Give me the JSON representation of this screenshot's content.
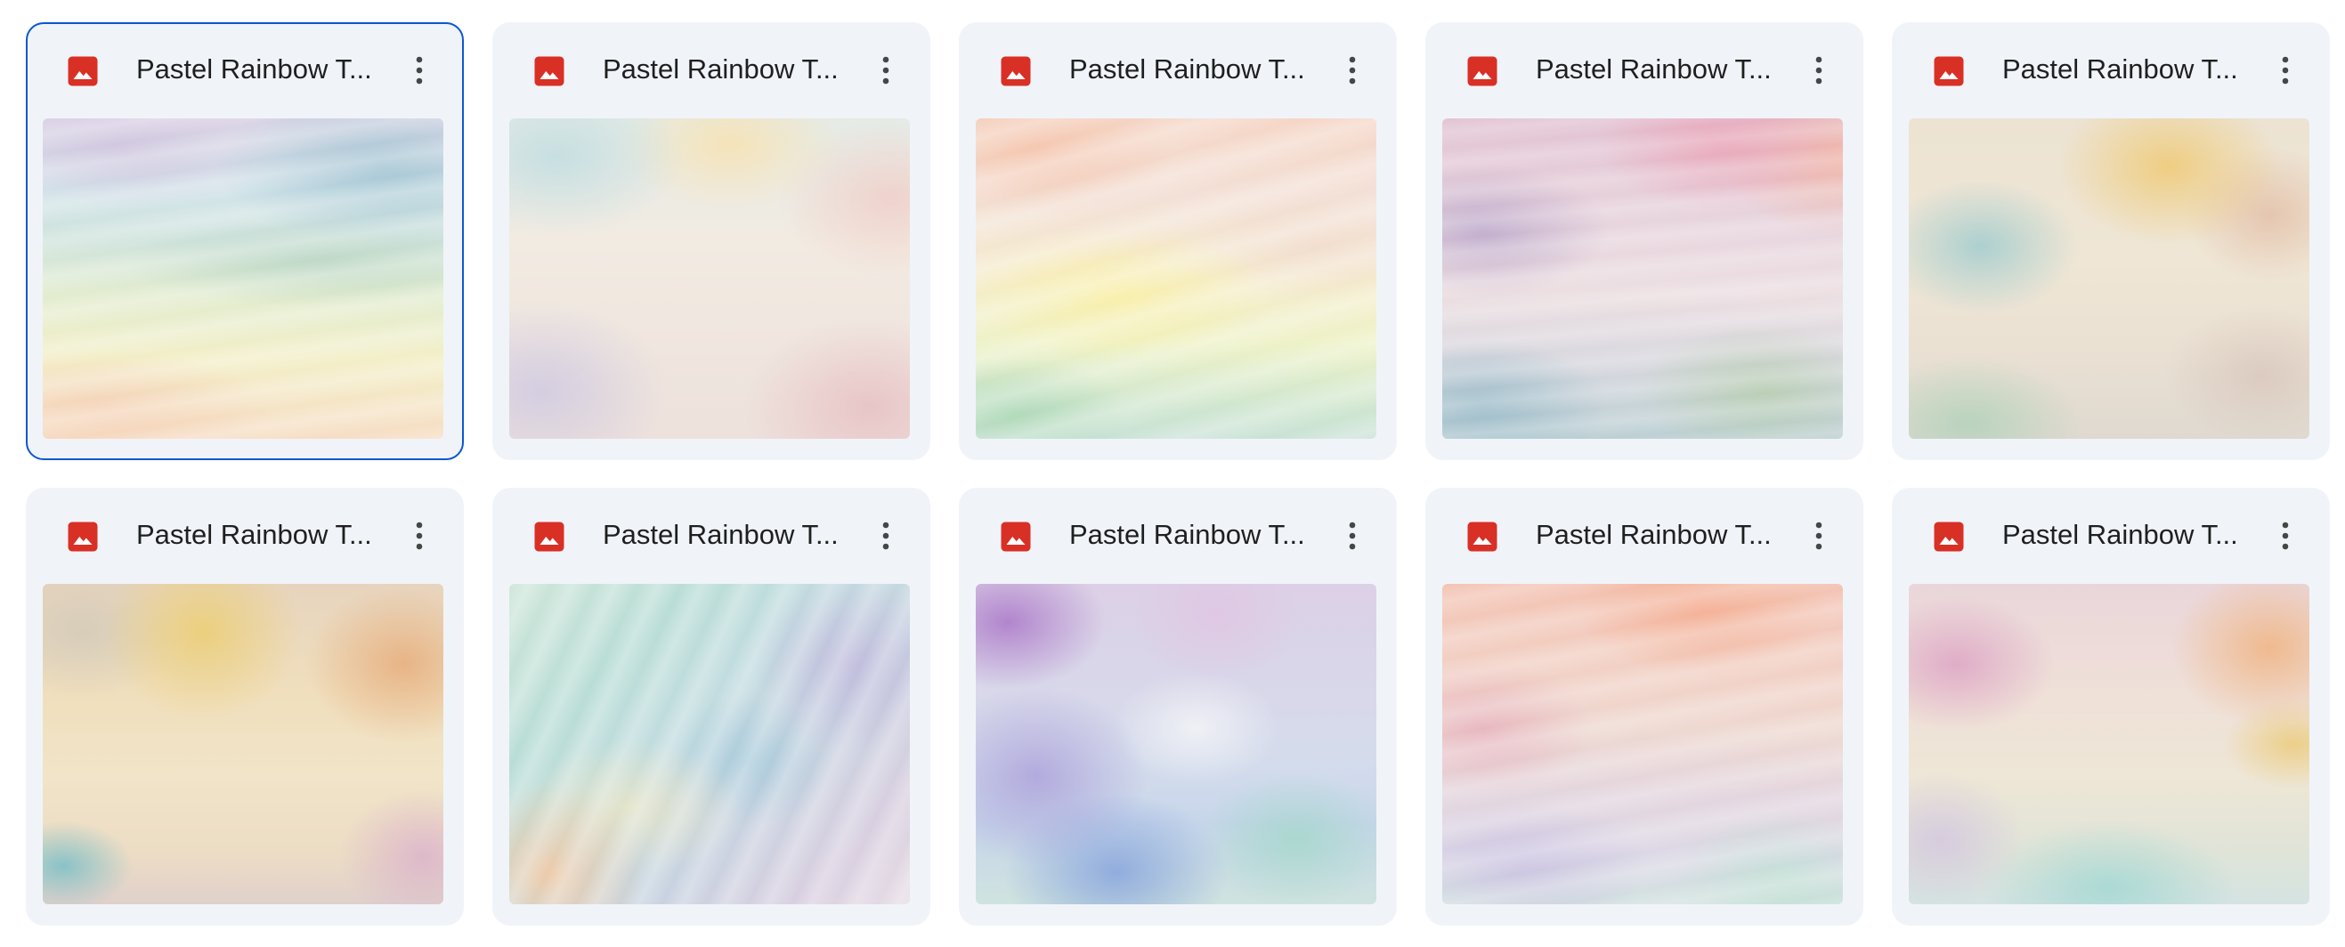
{
  "files": [
    {
      "name": "Pastel Rainbow T...",
      "selected": true,
      "icon": "image-file-icon",
      "thumbnail": "pastel-waves-cool"
    },
    {
      "name": "Pastel Rainbow T...",
      "selected": false,
      "icon": "image-file-icon",
      "thumbnail": "pastel-soft-haze"
    },
    {
      "name": "Pastel Rainbow T...",
      "selected": false,
      "icon": "image-file-icon",
      "thumbnail": "pastel-dunes-yellow"
    },
    {
      "name": "Pastel Rainbow T...",
      "selected": false,
      "icon": "image-file-icon",
      "thumbnail": "pastel-pink-violet"
    },
    {
      "name": "Pastel Rainbow T...",
      "selected": false,
      "icon": "image-file-icon",
      "thumbnail": "pastel-gold-teal-brush"
    },
    {
      "name": "Pastel Rainbow T...",
      "selected": false,
      "icon": "image-file-icon",
      "thumbnail": "pastel-watercolor-warm"
    },
    {
      "name": "Pastel Rainbow T...",
      "selected": false,
      "icon": "image-file-icon",
      "thumbnail": "pastel-teal-blue-strokes"
    },
    {
      "name": "Pastel Rainbow T...",
      "selected": false,
      "icon": "image-file-icon",
      "thumbnail": "pastel-violet-blue-fur"
    },
    {
      "name": "Pastel Rainbow T...",
      "selected": false,
      "icon": "image-file-icon",
      "thumbnail": "pastel-coral-lavender"
    },
    {
      "name": "Pastel Rainbow T...",
      "selected": false,
      "icon": "image-file-icon",
      "thumbnail": "pastel-pink-orange-mint"
    }
  ],
  "colors": {
    "card_background": "#f0f4f9",
    "selection_border": "#0b57d0",
    "image_icon": "#d93025",
    "title_text": "#1f1f1f",
    "more_icon": "#444746"
  }
}
